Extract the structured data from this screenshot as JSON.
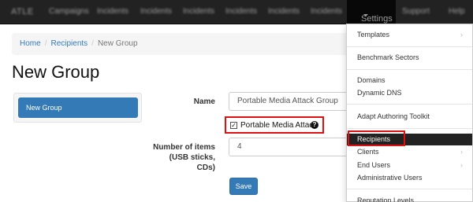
{
  "navbar": {
    "brand": "ATLE",
    "items": [
      "Campaigns",
      "Incidents",
      "Incidents",
      "Incidents",
      "Incidents",
      "Incidents",
      "Incidents"
    ],
    "settings_label": "Settings",
    "support_label": "Support",
    "help_label": "Help"
  },
  "breadcrumb": {
    "home": "Home",
    "recipients": "Recipients",
    "current": "New Group"
  },
  "page_title": "New Group",
  "sidebar": {
    "active_item": "New Group"
  },
  "form": {
    "name_label": "Name",
    "name_value": "Portable Media Attack Group",
    "checkbox_label": "Portable Media Attack",
    "checkbox_checked": true,
    "items_label_line1": "Number of items",
    "items_label_line2": "(USB sticks,",
    "items_label_line3": "CDs)",
    "items_value": "4",
    "save_label": "Save"
  },
  "settings_menu": {
    "items": [
      {
        "label": "Templates",
        "has_submenu": true
      },
      {
        "label": "Benchmark Sectors",
        "has_submenu": false
      },
      {
        "label": "Domains",
        "has_submenu": false
      },
      {
        "label": "Dynamic DNS",
        "has_submenu": false
      },
      {
        "label": "Adapt Authoring Toolkit",
        "has_submenu": false
      },
      {
        "label": "Recipients",
        "has_submenu": false,
        "active": true
      },
      {
        "label": "Clients",
        "has_submenu": true
      },
      {
        "label": "End Users",
        "has_submenu": true
      },
      {
        "label": "Administrative Users",
        "has_submenu": false
      },
      {
        "label": "Reputation Levels",
        "has_submenu": false
      }
    ],
    "submenu_indicator": "›"
  },
  "colors": {
    "navbar_bg": "#222222",
    "primary": "#337ab7",
    "highlight_border": "#e01010",
    "menu_active_bg": "#222222"
  }
}
